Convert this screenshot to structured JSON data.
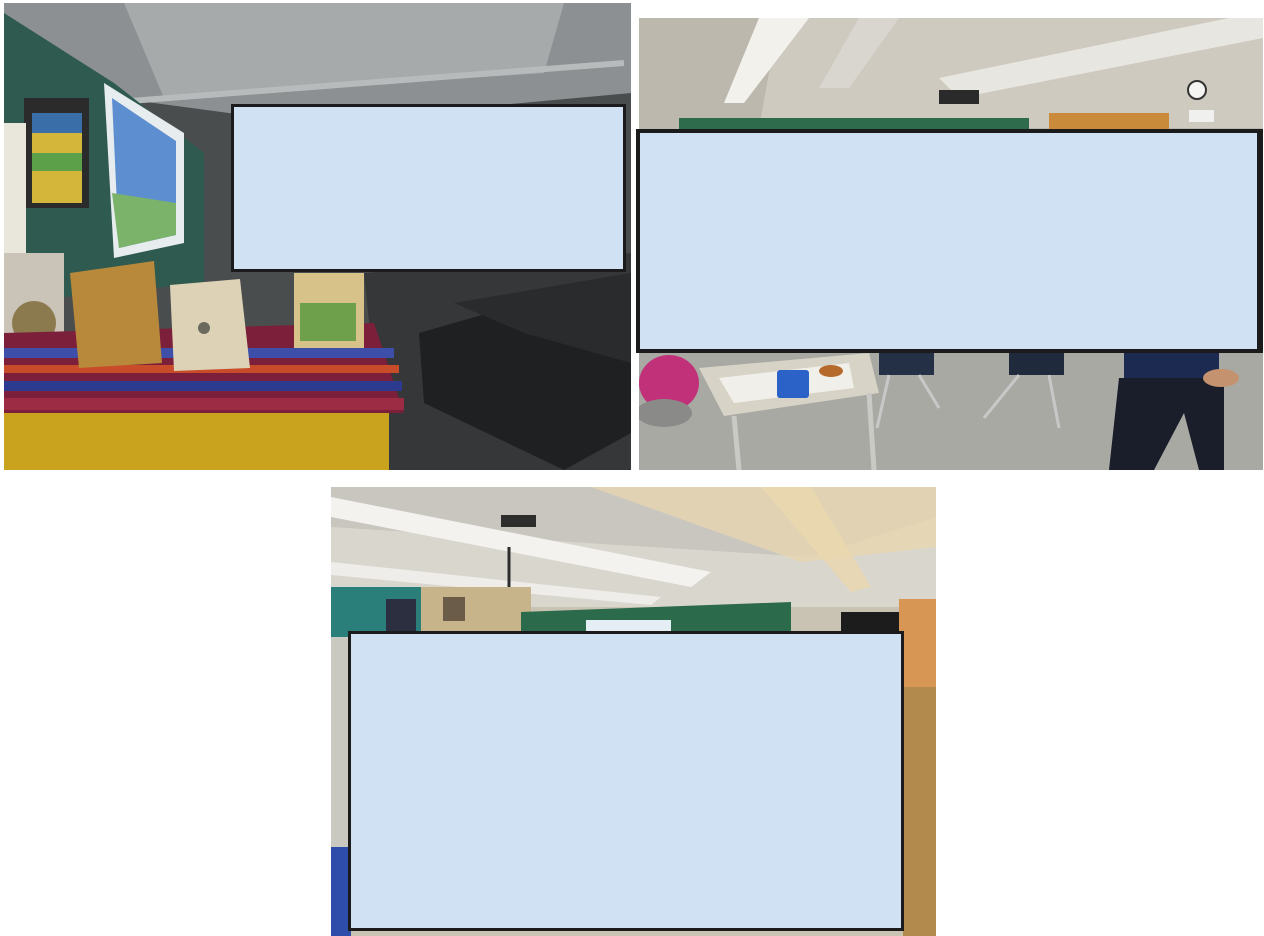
{
  "photos": [
    {
      "subject": "classroom-front-with-projector-screen",
      "redacted_regions": 1
    },
    {
      "subject": "classroom-back-with-tables-and-chairs",
      "redacted_regions": 1
    },
    {
      "subject": "classroom-ceiling-and-projector",
      "redacted_regions": 1
    }
  ],
  "colors": {
    "redaction_fill": "#cfe1f3",
    "redaction_border": "#1b1b1b",
    "background": "#ffffff"
  }
}
